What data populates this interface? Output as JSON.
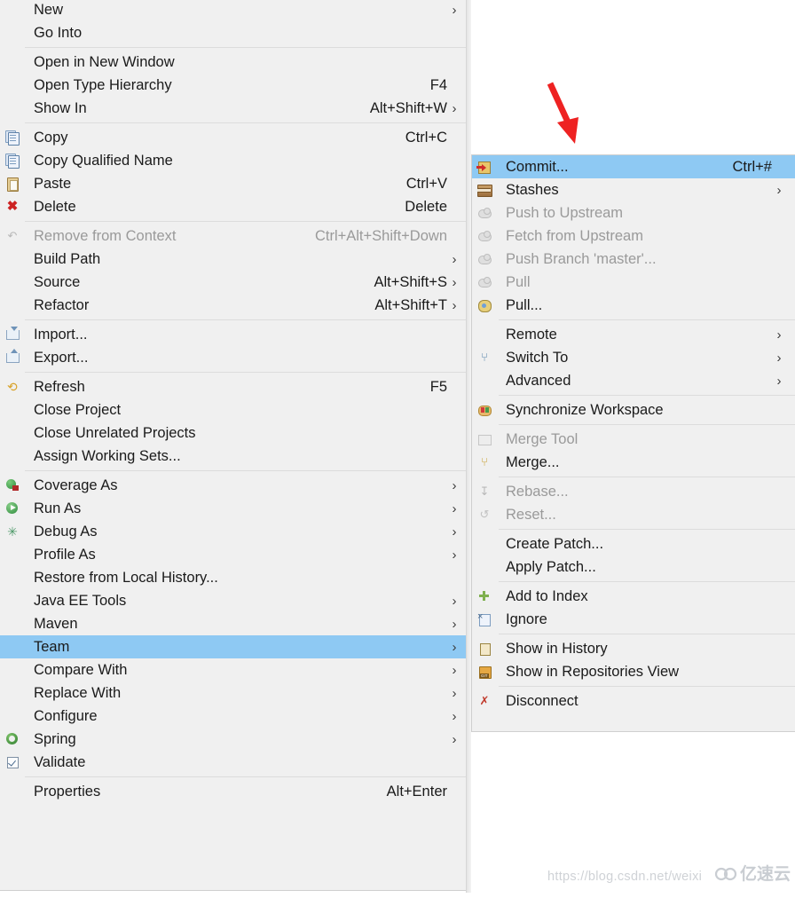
{
  "context_menu": {
    "name": "Eclipse project context menu",
    "groups": [
      {
        "items": [
          {
            "label": "New",
            "accel": "",
            "arrow": true,
            "icon": "",
            "disabled": false
          },
          {
            "label": "Go Into",
            "accel": "",
            "arrow": false,
            "icon": "",
            "disabled": false
          }
        ]
      },
      {
        "items": [
          {
            "label": "Open in New Window",
            "accel": "",
            "arrow": false,
            "icon": "",
            "disabled": false
          },
          {
            "label": "Open Type Hierarchy",
            "accel": "F4",
            "arrow": false,
            "icon": "",
            "disabled": false
          },
          {
            "label": "Show In",
            "accel": "Alt+Shift+W",
            "arrow": true,
            "icon": "",
            "disabled": false
          }
        ]
      },
      {
        "items": [
          {
            "label": "Copy",
            "accel": "Ctrl+C",
            "arrow": false,
            "icon": "copy-icon",
            "disabled": false
          },
          {
            "label": "Copy Qualified Name",
            "accel": "",
            "arrow": false,
            "icon": "copy-qualified-name-icon",
            "disabled": false
          },
          {
            "label": "Paste",
            "accel": "Ctrl+V",
            "arrow": false,
            "icon": "paste-icon",
            "disabled": false
          },
          {
            "label": "Delete",
            "accel": "Delete",
            "arrow": false,
            "icon": "delete-icon",
            "disabled": false
          }
        ]
      },
      {
        "items": [
          {
            "label": "Remove from Context",
            "accel": "Ctrl+Alt+Shift+Down",
            "arrow": false,
            "icon": "remove-from-context-icon",
            "disabled": true
          },
          {
            "label": "Build Path",
            "accel": "",
            "arrow": true,
            "icon": "",
            "disabled": false
          },
          {
            "label": "Source",
            "accel": "Alt+Shift+S",
            "arrow": true,
            "icon": "",
            "disabled": false
          },
          {
            "label": "Refactor",
            "accel": "Alt+Shift+T",
            "arrow": true,
            "icon": "",
            "disabled": false
          }
        ]
      },
      {
        "items": [
          {
            "label": "Import...",
            "accel": "",
            "arrow": false,
            "icon": "import-icon",
            "disabled": false
          },
          {
            "label": "Export...",
            "accel": "",
            "arrow": false,
            "icon": "export-icon",
            "disabled": false
          }
        ]
      },
      {
        "items": [
          {
            "label": "Refresh",
            "accel": "F5",
            "arrow": false,
            "icon": "refresh-icon",
            "disabled": false
          },
          {
            "label": "Close Project",
            "accel": "",
            "arrow": false,
            "icon": "",
            "disabled": false
          },
          {
            "label": "Close Unrelated Projects",
            "accel": "",
            "arrow": false,
            "icon": "",
            "disabled": false
          },
          {
            "label": "Assign Working Sets...",
            "accel": "",
            "arrow": false,
            "icon": "",
            "disabled": false
          }
        ]
      },
      {
        "items": [
          {
            "label": "Coverage As",
            "accel": "",
            "arrow": true,
            "icon": "coverage-icon",
            "disabled": false
          },
          {
            "label": "Run As",
            "accel": "",
            "arrow": true,
            "icon": "run-icon",
            "disabled": false
          },
          {
            "label": "Debug As",
            "accel": "",
            "arrow": true,
            "icon": "debug-bug-icon",
            "disabled": false
          },
          {
            "label": "Profile As",
            "accel": "",
            "arrow": true,
            "icon": "",
            "disabled": false
          },
          {
            "label": "Restore from Local History...",
            "accel": "",
            "arrow": false,
            "icon": "",
            "disabled": false
          },
          {
            "label": "Java EE Tools",
            "accel": "",
            "arrow": true,
            "icon": "",
            "disabled": false
          },
          {
            "label": "Maven",
            "accel": "",
            "arrow": true,
            "icon": "",
            "disabled": false
          },
          {
            "label": "Team",
            "accel": "",
            "arrow": true,
            "icon": "",
            "disabled": false,
            "selected": true
          },
          {
            "label": "Compare With",
            "accel": "",
            "arrow": true,
            "icon": "",
            "disabled": false
          },
          {
            "label": "Replace With",
            "accel": "",
            "arrow": true,
            "icon": "",
            "disabled": false
          },
          {
            "label": "Configure",
            "accel": "",
            "arrow": true,
            "icon": "",
            "disabled": false
          },
          {
            "label": "Spring",
            "accel": "",
            "arrow": true,
            "icon": "spring-leaf-icon",
            "disabled": false
          },
          {
            "label": "Validate",
            "accel": "",
            "arrow": false,
            "icon": "validate-checkbox-icon",
            "disabled": false
          }
        ]
      },
      {
        "items": [
          {
            "label": "Properties",
            "accel": "Alt+Enter",
            "arrow": false,
            "icon": "",
            "disabled": false
          }
        ]
      }
    ]
  },
  "submenu": {
    "name": "Team submenu",
    "groups": [
      {
        "items": [
          {
            "label": "Commit...",
            "accel": "Ctrl+#",
            "arrow": false,
            "icon": "commit-icon",
            "disabled": false,
            "selected": true
          },
          {
            "label": "Stashes",
            "accel": "",
            "arrow": true,
            "icon": "stashes-icon",
            "disabled": false
          },
          {
            "label": "Push to Upstream",
            "accel": "",
            "arrow": false,
            "icon": "push-cloud-icon",
            "disabled": true
          },
          {
            "label": "Fetch from Upstream",
            "accel": "",
            "arrow": false,
            "icon": "fetch-cloud-icon",
            "disabled": true
          },
          {
            "label": "Push Branch 'master'...",
            "accel": "",
            "arrow": false,
            "icon": "push-branch-cloud-icon",
            "disabled": true
          },
          {
            "label": "Pull",
            "accel": "",
            "arrow": false,
            "icon": "pull-cloud-icon",
            "disabled": true
          },
          {
            "label": "Pull...",
            "accel": "",
            "arrow": false,
            "icon": "pull-config-icon",
            "disabled": false
          }
        ]
      },
      {
        "items": [
          {
            "label": "Remote",
            "accel": "",
            "arrow": true,
            "icon": "",
            "disabled": false
          },
          {
            "label": "Switch To",
            "accel": "",
            "arrow": true,
            "icon": "switch-to-icon",
            "disabled": false
          },
          {
            "label": "Advanced",
            "accel": "",
            "arrow": true,
            "icon": "",
            "disabled": false
          }
        ]
      },
      {
        "items": [
          {
            "label": "Synchronize Workspace",
            "accel": "",
            "arrow": false,
            "icon": "synchronize-icon",
            "disabled": false
          }
        ]
      },
      {
        "items": [
          {
            "label": "Merge Tool",
            "accel": "",
            "arrow": false,
            "icon": "merge-tool-icon",
            "disabled": true
          },
          {
            "label": "Merge...",
            "accel": "",
            "arrow": false,
            "icon": "merge-icon",
            "disabled": false
          }
        ]
      },
      {
        "items": [
          {
            "label": "Rebase...",
            "accel": "",
            "arrow": false,
            "icon": "rebase-icon",
            "disabled": true
          },
          {
            "label": "Reset...",
            "accel": "",
            "arrow": false,
            "icon": "reset-icon",
            "disabled": true
          }
        ]
      },
      {
        "items": [
          {
            "label": "Create Patch...",
            "accel": "",
            "arrow": false,
            "icon": "",
            "disabled": false
          },
          {
            "label": "Apply Patch...",
            "accel": "",
            "arrow": false,
            "icon": "",
            "disabled": false
          }
        ]
      },
      {
        "items": [
          {
            "label": "Add to Index",
            "accel": "",
            "arrow": false,
            "icon": "add-to-index-icon",
            "disabled": false
          },
          {
            "label": "Ignore",
            "accel": "",
            "arrow": false,
            "icon": "ignore-icon",
            "disabled": false
          }
        ]
      },
      {
        "items": [
          {
            "label": "Show in History",
            "accel": "",
            "arrow": false,
            "icon": "history-icon",
            "disabled": false
          },
          {
            "label": "Show in Repositories View",
            "accel": "",
            "arrow": false,
            "icon": "git-repository-icon",
            "disabled": false
          }
        ]
      },
      {
        "items": [
          {
            "label": "Disconnect",
            "accel": "",
            "arrow": false,
            "icon": "disconnect-icon",
            "disabled": false
          }
        ]
      }
    ]
  },
  "annotation": {
    "arrow_color": "#ee2222",
    "points_to": "Commit..."
  },
  "watermark": {
    "url_text": "https://blog.csdn.net/weixi",
    "logo_glyph": "ΔΔ",
    "logo_text": "亿速云"
  },
  "colors": {
    "menu_background": "#f0f0f0",
    "selection": "#8ec9f3",
    "text": "#1a1a1a",
    "disabled_text": "#9a9a9a",
    "separator": "#dcdcdc"
  }
}
